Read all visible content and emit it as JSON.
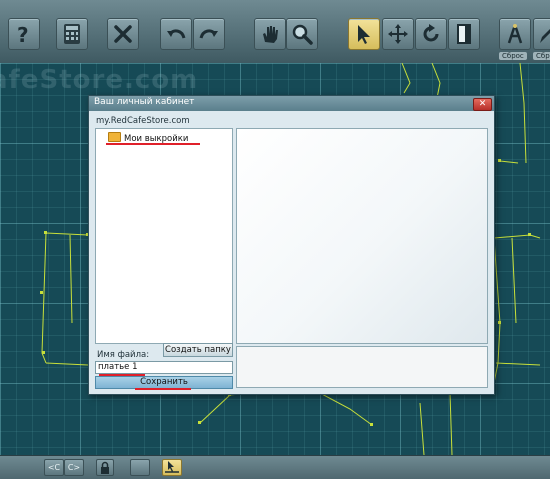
{
  "toolbar": {
    "tools": [
      {
        "name": "help",
        "icon": "question-icon"
      },
      {
        "name": "calculator",
        "icon": "calculator-icon"
      },
      {
        "name": "delete",
        "icon": "close-icon"
      },
      {
        "name": "undo",
        "icon": "undo-icon"
      },
      {
        "name": "redo",
        "icon": "redo-icon"
      },
      {
        "name": "pan",
        "icon": "hand-icon"
      },
      {
        "name": "zoom",
        "icon": "magnifier-icon"
      },
      {
        "name": "select",
        "icon": "arrow-pointer-icon",
        "active": true
      },
      {
        "name": "move",
        "icon": "move-arrows-icon"
      },
      {
        "name": "rotate",
        "icon": "rotate-icon"
      },
      {
        "name": "page",
        "icon": "page-icon"
      },
      {
        "name": "tool-a",
        "icon": "compass-icon"
      },
      {
        "name": "tool-b",
        "icon": "pencil-icon"
      }
    ],
    "reset_labels": [
      "Сброс",
      "Сброс"
    ]
  },
  "canvas": {
    "watermark": "afeStore.com"
  },
  "dialog": {
    "title": "Ваш личный кабинет",
    "close_glyph": "✕",
    "site": "my.RedCafeStore.com",
    "tree_item": "Мои выкройки",
    "create_folder_label": "Создать папку",
    "filename_label": "Имя файла:",
    "filename_value": "платье 1",
    "save_label": "Сохранить"
  },
  "bottombar": {
    "prev_label": "<C",
    "next_label": "C>"
  },
  "colors": {
    "highlight": "#e0202a",
    "pattern_line": "#c8e03a",
    "active_tool": "#e8d27a"
  }
}
